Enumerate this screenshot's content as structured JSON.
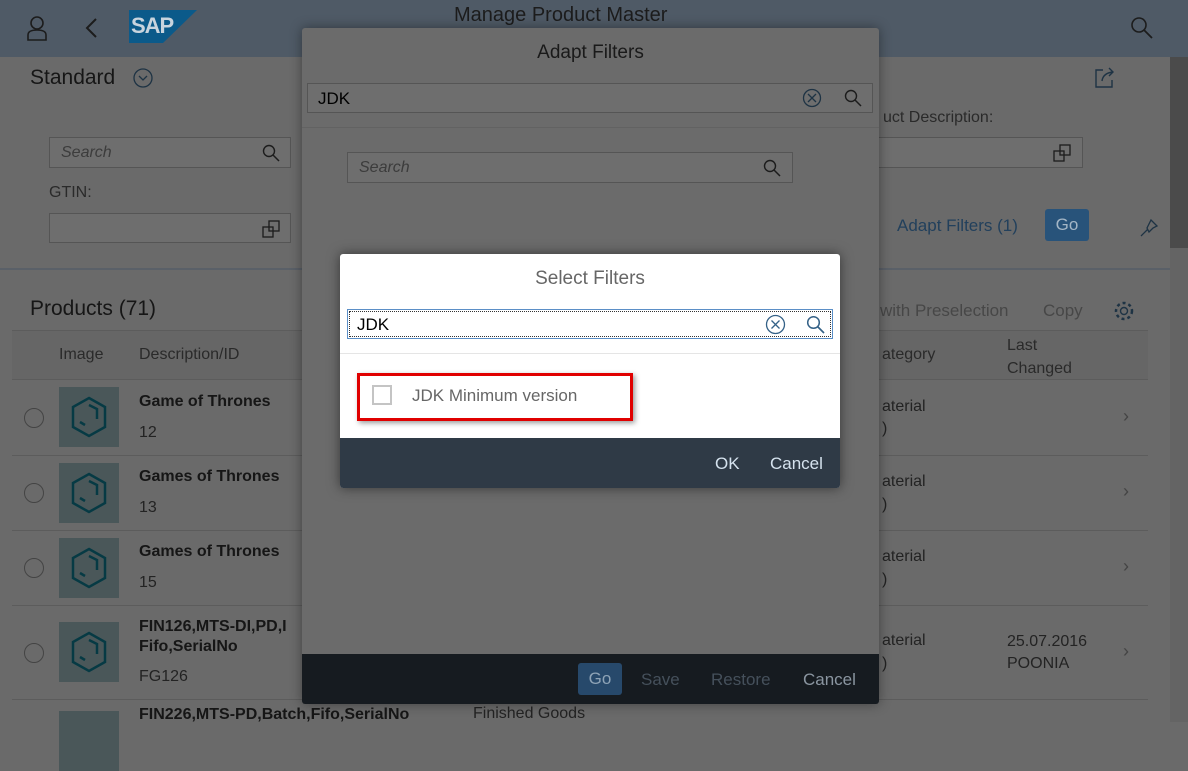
{
  "shell": {
    "title": "Manage Product Master",
    "logo": "SAP"
  },
  "filterbar": {
    "variant": "Standard",
    "search_placeholder": "Search",
    "gtin_label": "GTIN:",
    "product_description_label": "uct Description:",
    "adapt_filters": "Adapt Filters (1)",
    "go": "Go"
  },
  "table": {
    "title": "Products (71)",
    "toolbar": {
      "preselection": "with Preselection",
      "copy": "Copy"
    },
    "columns": {
      "image": "Image",
      "description": "Description/ID",
      "category": "ategory",
      "last_changed_1": "Last",
      "last_changed_2": "Changed"
    },
    "rows": [
      {
        "title": "Game of Thrones",
        "id": "12",
        "category": "aterial",
        "category2": ")",
        "changed": "",
        "changed_by": ""
      },
      {
        "title": "Games of Thrones",
        "id": "13",
        "category": "aterial",
        "category2": ")",
        "changed": "",
        "changed_by": ""
      },
      {
        "title": "Games of Thrones",
        "id": "15",
        "category": "aterial",
        "category2": ")",
        "changed": "",
        "changed_by": ""
      },
      {
        "title": "FIN126,MTS-DI,PD,I",
        "title2": "Fifo,SerialNo",
        "id": "FG126",
        "category": "aterial",
        "category2": ")",
        "changed": "25.07.2016",
        "changed_by": "POONIA"
      },
      {
        "title": "FIN226,MTS-PD,Batch,Fifo,SerialNo",
        "id": "",
        "category": "Finished Goods"
      }
    ]
  },
  "adapt_dialog": {
    "title": "Adapt Filters",
    "search_value": "JDK",
    "inner_search_placeholder": "Search",
    "footer": {
      "go": "Go",
      "save": "Save",
      "restore": "Restore",
      "cancel": "Cancel"
    }
  },
  "select_dialog": {
    "title": "Select Filters",
    "search_value": "JDK",
    "items": [
      {
        "label": "JDK Minimum version",
        "checked": false
      }
    ],
    "ok": "OK",
    "cancel": "Cancel"
  },
  "colors": {
    "accent": "#346187",
    "highlight": "#e00000",
    "footer": "#2f3a46"
  }
}
